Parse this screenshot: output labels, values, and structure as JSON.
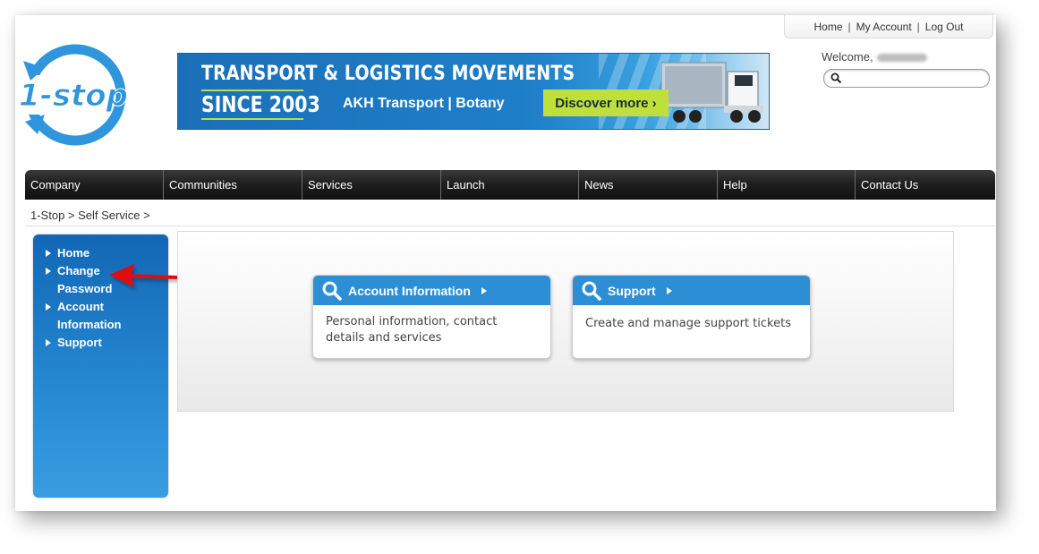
{
  "top_links": {
    "home": "Home",
    "my_account": "My Account",
    "log_out": "Log Out",
    "separator": "|"
  },
  "logo": {
    "text": "1-stop"
  },
  "banner": {
    "headline": "TRANSPORT & LOGISTICS MOVEMENTS",
    "since": "SINCE 2003",
    "subtitle": "AKH Transport  |  Botany",
    "cta": "Discover more ›"
  },
  "user": {
    "welcome": "Welcome,"
  },
  "search": {
    "placeholder": "",
    "value": ""
  },
  "nav": [
    {
      "label": "Company"
    },
    {
      "label": "Communities"
    },
    {
      "label": "Services"
    },
    {
      "label": "Launch"
    },
    {
      "label": "News"
    },
    {
      "label": "Help"
    },
    {
      "label": "Contact Us"
    }
  ],
  "breadcrumb": "1-Stop > Self Service >",
  "sidebar": {
    "items": [
      {
        "label": "Home"
      },
      {
        "label": "Change Password"
      },
      {
        "label": "Account Information"
      },
      {
        "label": "Support"
      }
    ]
  },
  "cards": [
    {
      "title": "Account Information",
      "desc": "Personal information, contact details and services"
    },
    {
      "title": "Support",
      "desc": "Create and manage support tickets"
    }
  ],
  "colors": {
    "accent_blue": "#2c8fd6",
    "nav_dark": "#1f1f1f",
    "annotation_red": "#e01010",
    "banner_green": "#bfe03a"
  }
}
